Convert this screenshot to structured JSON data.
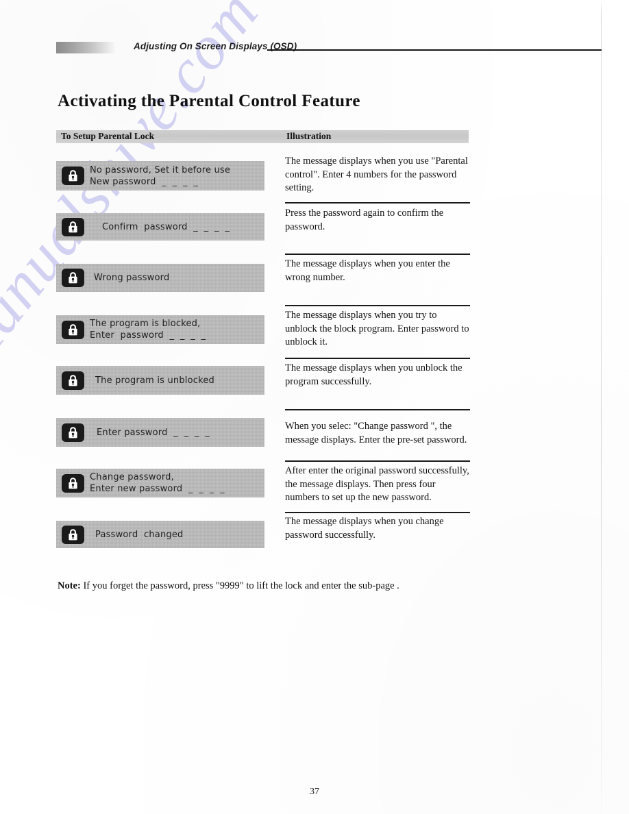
{
  "header": {
    "running_title": "Adjusting On Screen Displays (OSD)",
    "swatch": "gradient-swatch"
  },
  "section": {
    "title": "Activating the Parental Control Feature"
  },
  "table": {
    "columns": {
      "left": "To Setup Parental Lock",
      "right": "Illustration"
    },
    "rows": [
      {
        "osd": {
          "icon": "padlock-icon",
          "line1": "No password, Set it before use",
          "line2": "New password  _  _  _  _"
        },
        "illustration": "The message displays when you use \"Parental control\". Enter 4 numbers for the password setting."
      },
      {
        "osd": {
          "icon": "padlock-icon",
          "line1": "Confirm  password  _  _  _  _",
          "line2": ""
        },
        "illustration": "Press the password again to confirm the password."
      },
      {
        "osd": {
          "icon": "padlock-icon",
          "line1": "Wrong password",
          "line2": ""
        },
        "illustration": "The message displays when you enter the wrong number."
      },
      {
        "osd": {
          "icon": "padlock-icon",
          "line1": "The program is blocked,",
          "line2": "Enter  password  _  _  _  _"
        },
        "illustration": "The message displays when you try to unblock the block program. Enter password to unblock it."
      },
      {
        "osd": {
          "icon": "padlock-icon",
          "line1": "The program is unblocked",
          "line2": ""
        },
        "illustration": "The message displays when you unblock the program successfully."
      },
      {
        "osd": {
          "icon": "padlock-icon",
          "line1": "Enter password  _  _  _  _",
          "line2": ""
        },
        "illustration": "When you selec: \"Change password \", the message displays. Enter the pre-set password."
      },
      {
        "osd": {
          "icon": "padlock-icon",
          "line1": "Change password,",
          "line2": "Enter new password  _  _  _  _"
        },
        "illustration": "After enter the original password successfully, the message displays. Then press four numbers to set up the new password."
      },
      {
        "osd": {
          "icon": "padlock-icon",
          "line1": "Password  changed",
          "line2": ""
        },
        "illustration": "The message displays when you change password successfully."
      }
    ]
  },
  "note": {
    "label": "Note:",
    "text": " If you forget the password, press \"9999\" to lift the lock and enter the sub-page ."
  },
  "folio": {
    "page_number": "37"
  },
  "watermark": {
    "text": "manualshive.com",
    "color": "#c9c8ef"
  }
}
